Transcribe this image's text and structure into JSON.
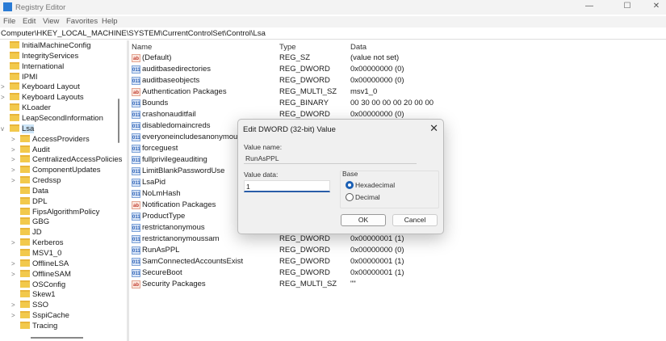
{
  "window": {
    "title": "Registry Editor",
    "controls": [
      "—",
      "☐",
      "✕"
    ]
  },
  "menu": [
    "File",
    "Edit",
    "View",
    "Favorites",
    "Help"
  ],
  "address": "Computer\\HKEY_LOCAL_MACHINE\\SYSTEM\\CurrentControlSet\\Control\\Lsa",
  "tree": [
    {
      "label": "InitialMachineConfig",
      "level": 0,
      "expand": ""
    },
    {
      "label": "IntegrityServices",
      "level": 0,
      "expand": ""
    },
    {
      "label": "International",
      "level": 0,
      "expand": ""
    },
    {
      "label": "IPMI",
      "level": 0,
      "expand": ""
    },
    {
      "label": "Keyboard Layout",
      "level": 0,
      "expand": ">"
    },
    {
      "label": "Keyboard Layouts",
      "level": 0,
      "expand": ">"
    },
    {
      "label": "KLoader",
      "level": 0,
      "expand": ""
    },
    {
      "label": "LeapSecondInformation",
      "level": 0,
      "expand": ""
    },
    {
      "label": "Lsa",
      "level": 0,
      "expand": "v",
      "selected": true
    },
    {
      "label": "AccessProviders",
      "level": 1,
      "expand": ">"
    },
    {
      "label": "Audit",
      "level": 1,
      "expand": ">"
    },
    {
      "label": "CentralizedAccessPolicies",
      "level": 1,
      "expand": ">"
    },
    {
      "label": "ComponentUpdates",
      "level": 1,
      "expand": ">"
    },
    {
      "label": "Credssp",
      "level": 1,
      "expand": ">"
    },
    {
      "label": "Data",
      "level": 1,
      "expand": ""
    },
    {
      "label": "DPL",
      "level": 1,
      "expand": ""
    },
    {
      "label": "FipsAlgorithmPolicy",
      "level": 1,
      "expand": ""
    },
    {
      "label": "GBG",
      "level": 1,
      "expand": ""
    },
    {
      "label": "JD",
      "level": 1,
      "expand": ""
    },
    {
      "label": "Kerberos",
      "level": 1,
      "expand": ">"
    },
    {
      "label": "MSV1_0",
      "level": 1,
      "expand": ""
    },
    {
      "label": "OfflineLSA",
      "level": 1,
      "expand": ">"
    },
    {
      "label": "OfflineSAM",
      "level": 1,
      "expand": ">"
    },
    {
      "label": "OSConfig",
      "level": 1,
      "expand": ""
    },
    {
      "label": "Skew1",
      "level": 1,
      "expand": ""
    },
    {
      "label": "SSO",
      "level": 1,
      "expand": ">"
    },
    {
      "label": "SspiCache",
      "level": 1,
      "expand": ">"
    },
    {
      "label": "Tracing",
      "level": 1,
      "expand": ""
    }
  ],
  "columns": {
    "name": "Name",
    "type": "Type",
    "data": "Data"
  },
  "values": [
    {
      "name": "(Default)",
      "type": "REG_SZ",
      "data": "(value not set)",
      "icon": "ab"
    },
    {
      "name": "auditbasedirectories",
      "type": "REG_DWORD",
      "data": "0x00000000 (0)",
      "icon": "bin"
    },
    {
      "name": "auditbaseobjects",
      "type": "REG_DWORD",
      "data": "0x00000000 (0)",
      "icon": "bin"
    },
    {
      "name": "Authentication Packages",
      "type": "REG_MULTI_SZ",
      "data": "msv1_0",
      "icon": "ab"
    },
    {
      "name": "Bounds",
      "type": "REG_BINARY",
      "data": "00 30 00 00 00 20 00 00",
      "icon": "bin"
    },
    {
      "name": "crashonauditfail",
      "type": "REG_DWORD",
      "data": "0x00000000 (0)",
      "icon": "bin"
    },
    {
      "name": "disabledomaincreds",
      "type": "",
      "data": "",
      "icon": "bin"
    },
    {
      "name": "everyoneincludesanonymous",
      "type": "",
      "data": "",
      "icon": "bin"
    },
    {
      "name": "forceguest",
      "type": "",
      "data": "",
      "icon": "bin"
    },
    {
      "name": "fullprivilegeauditing",
      "type": "",
      "data": "",
      "icon": "bin"
    },
    {
      "name": "LimitBlankPasswordUse",
      "type": "",
      "data": "",
      "icon": "bin"
    },
    {
      "name": "LsaPid",
      "type": "",
      "data": "",
      "icon": "bin"
    },
    {
      "name": "NoLmHash",
      "type": "",
      "data": "",
      "icon": "bin"
    },
    {
      "name": "Notification Packages",
      "type": "",
      "data": "",
      "icon": "ab"
    },
    {
      "name": "ProductType",
      "type": "",
      "data": "",
      "icon": "bin"
    },
    {
      "name": "restrictanonymous",
      "type": "",
      "data": "",
      "icon": "bin"
    },
    {
      "name": "restrictanonymoussam",
      "type": "REG_DWORD",
      "data": "0x00000001 (1)",
      "icon": "bin"
    },
    {
      "name": "RunAsPPL",
      "type": "REG_DWORD",
      "data": "0x00000000 (0)",
      "icon": "bin"
    },
    {
      "name": "SamConnectedAccountsExist",
      "type": "REG_DWORD",
      "data": "0x00000001 (1)",
      "icon": "bin"
    },
    {
      "name": "SecureBoot",
      "type": "REG_DWORD",
      "data": "0x00000001 (1)",
      "icon": "bin"
    },
    {
      "name": "Security Packages",
      "type": "REG_MULTI_SZ",
      "data": "\"\"",
      "icon": "ab"
    }
  ],
  "dialog": {
    "title": "Edit DWORD (32-bit) Value",
    "value_name_label": "Value name:",
    "value_name": "RunAsPPL",
    "value_data_label": "Value data:",
    "value_data": "1",
    "base_label": "Base",
    "hex_label": "Hexadecimal",
    "dec_label": "Decimal",
    "base_selected": "Hexadecimal",
    "ok": "OK",
    "cancel": "Cancel",
    "close": "✕"
  }
}
